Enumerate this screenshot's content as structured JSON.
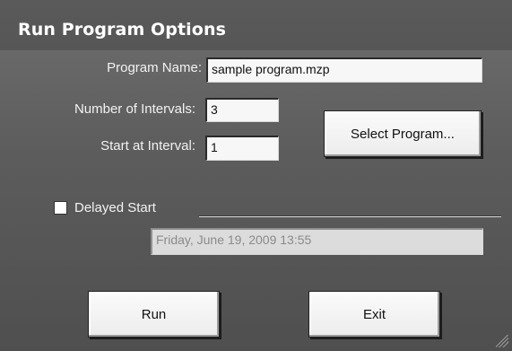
{
  "window": {
    "title": "Run Program Options"
  },
  "form": {
    "program_name_label": "Program Name:",
    "program_name_value": "sample program.mzp",
    "intervals_label": "Number of Intervals:",
    "intervals_value": "3",
    "start_label": "Start at Interval:",
    "start_value": "1",
    "select_program_label": "Select Program...",
    "delayed_start_label": "Delayed Start",
    "delayed_start_checked": false,
    "delayed_start_datetime": "Friday, June 19, 2009 13:55"
  },
  "buttons": {
    "run_label": "Run",
    "exit_label": "Exit"
  }
}
